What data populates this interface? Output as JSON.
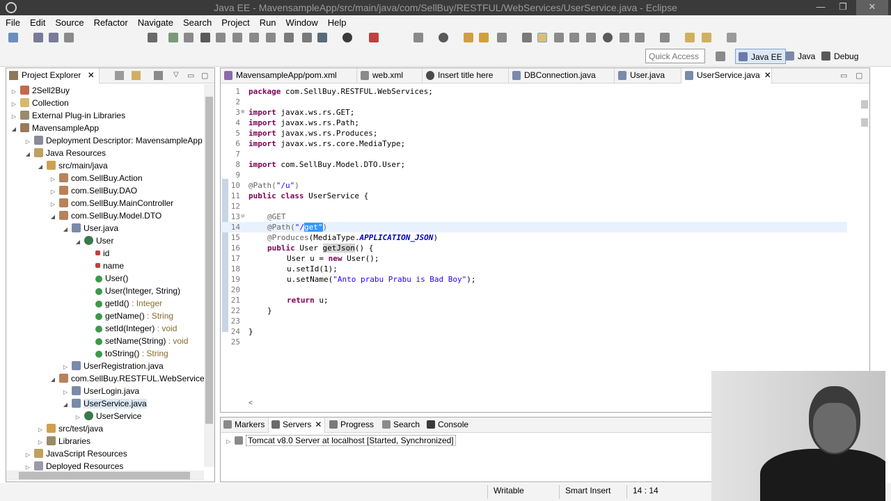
{
  "window": {
    "title": "Java EE - MavensampleApp/src/main/java/com/SellBuy/RESTFUL/WebServices/UserService.java - Eclipse"
  },
  "menu": [
    "File",
    "Edit",
    "Source",
    "Refactor",
    "Navigate",
    "Search",
    "Project",
    "Run",
    "Window",
    "Help"
  ],
  "quick_access": {
    "placeholder": "Quick Access"
  },
  "perspectives": [
    "Java EE",
    "Java",
    "Debug"
  ],
  "explorer": {
    "title": "Project Explorer",
    "tree": [
      {
        "label": "2Sell2Buy"
      },
      {
        "label": "Collection"
      },
      {
        "label": "External Plug-in Libraries"
      },
      {
        "label": "MavensampleApp"
      },
      {
        "label": "Deployment Descriptor: MavensampleApp"
      },
      {
        "label": "Java Resources"
      },
      {
        "label": "src/main/java"
      },
      {
        "label": "com.SellBuy.Action"
      },
      {
        "label": "com.SellBuy.DAO"
      },
      {
        "label": "com.SellBuy.MainController"
      },
      {
        "label": "com.SellBuy.Model.DTO"
      },
      {
        "label": "User.java"
      },
      {
        "label": "User"
      },
      {
        "label": "id"
      },
      {
        "label": "name"
      },
      {
        "label": "User()"
      },
      {
        "label": "User(Integer, String)"
      },
      {
        "label": "getId()",
        "rtype": " : Integer"
      },
      {
        "label": "getName()",
        "rtype": " : String"
      },
      {
        "label": "setId(Integer)",
        "rtype": " : void"
      },
      {
        "label": "setName(String)",
        "rtype": " : void"
      },
      {
        "label": "toString()",
        "rtype": " : String"
      },
      {
        "label": "UserRegistration.java"
      },
      {
        "label": "com.SellBuy.RESTFUL.WebServices"
      },
      {
        "label": "UserLogin.java"
      },
      {
        "label": "UserService.java"
      },
      {
        "label": "UserService"
      },
      {
        "label": "src/test/java"
      },
      {
        "label": "Libraries"
      },
      {
        "label": "JavaScript Resources"
      },
      {
        "label": "Deployed Resources"
      }
    ]
  },
  "editor_tabs": [
    "MavensampleApp/pom.xml",
    "web.xml",
    "Insert title here",
    "DBConnection.java",
    "User.java",
    "UserService.java"
  ],
  "code": {
    "line_numbers": [
      "1",
      "2",
      "3",
      "4",
      "5",
      "6",
      "7",
      "8",
      "9",
      "10",
      "11",
      "12",
      "13",
      "14",
      "15",
      "16",
      "17",
      "18",
      "19",
      "20",
      "21",
      "22",
      "23",
      "24",
      "25"
    ],
    "l1_kw": "package",
    "l1_rest": " com.SellBuy.RESTFUL.WebServices;",
    "import_kw": "import",
    "l3_rest": " javax.ws.rs.GET;",
    "l4_rest": " javax.ws.rs.Path;",
    "l5_rest": " javax.ws.rs.Produces;",
    "l6_rest": " javax.ws.rs.core.MediaType;",
    "l8_rest": " com.SellBuy.Model.DTO.User;",
    "l10_an": "@Path(",
    "l10_str": "\"/u\"",
    "l10_close": ")",
    "l11_kw1": "public",
    "l11_kw2": "class",
    "l11_rest": " UserService {",
    "l13_an": "@GET",
    "l14_an": "@Path(",
    "l14_str_a": "\"/",
    "l14_sel": "get\"",
    "l14_close": ")",
    "l15_an": "@Produces",
    "l15_mid": "(MediaType.",
    "l15_const": "APPLICATION_JSON",
    "l15_close": ")",
    "l16_kw": "public",
    "l16_mid": " User ",
    "l16_occ": "getJson",
    "l16_rest": "() {",
    "l17_pre": "User u = ",
    "l17_kw": "new",
    "l17_rest": " User();",
    "l18": "u.setId(1);",
    "l19_pre": "u.setName(",
    "l19_str": "\"Anto prabu Prabu is Bad Boy\"",
    "l19_rest": ");",
    "l21_kw": "return",
    "l21_rest": " u;",
    "l22": "}",
    "l24": "}"
  },
  "bottom_tabs": [
    "Markers",
    "Servers",
    "Progress",
    "Search",
    "Console"
  ],
  "servers": {
    "entry": "Tomcat v8.0 Server at localhost  [Started, Synchronized]"
  },
  "status": {
    "writable": "Writable",
    "insert_mode": "Smart Insert",
    "position": "14 : 14"
  },
  "colors": {
    "keyword": "#7f0055",
    "string": "#2a00ff",
    "annotation": "#646464",
    "constant": "#0000c0",
    "selection": "#3399ff"
  }
}
